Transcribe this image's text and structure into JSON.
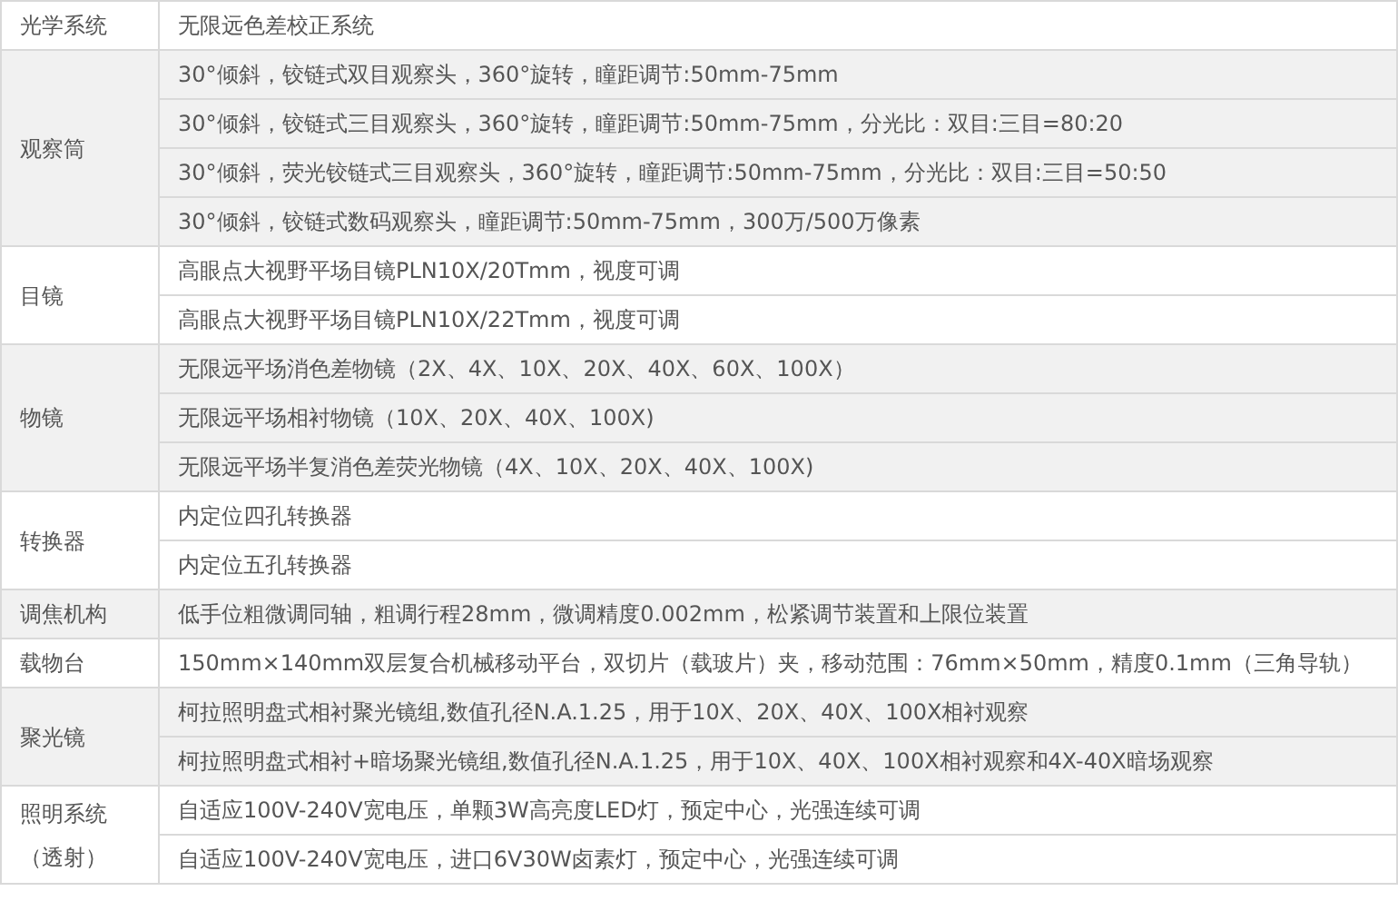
{
  "spec_table": [
    {
      "category": "光学系统",
      "values": [
        "无限远色差校正系统"
      ]
    },
    {
      "category": "观察筒",
      "values": [
        "30°倾斜，铰链式双目观察头，360°旋转，瞳距调节:50mm-75mm",
        "30°倾斜，铰链式三目观察头，360°旋转，瞳距调节:50mm-75mm，分光比：双目:三目=80:20",
        "30°倾斜，荧光铰链式三目观察头，360°旋转，瞳距调节:50mm-75mm，分光比：双目:三目=50:50",
        "30°倾斜，铰链式数码观察头，瞳距调节:50mm-75mm，300万/500万像素"
      ]
    },
    {
      "category": "目镜",
      "values": [
        "高眼点大视野平场目镜PLN10X/20Tmm，视度可调",
        "高眼点大视野平场目镜PLN10X/22Tmm，视度可调"
      ]
    },
    {
      "category": "物镜",
      "values": [
        "无限远平场消色差物镜（2X、4X、10X、20X、40X、60X、100X）",
        "无限远平场相衬物镜（10X、20X、40X、100X)",
        "无限远平场半复消色差荧光物镜（4X、10X、20X、40X、100X)"
      ]
    },
    {
      "category": "转换器",
      "values": [
        "内定位四孔转换器",
        "内定位五孔转换器"
      ]
    },
    {
      "category": "调焦机构",
      "values": [
        "低手位粗微调同轴，粗调行程28mm，微调精度0.002mm，松紧调节装置和上限位装置"
      ]
    },
    {
      "category": "载物台",
      "values": [
        "150mm×140mm双层复合机械移动平台，双切片（载玻片）夹，移动范围：76mm×50mm，精度0.1mm（三角导轨）"
      ]
    },
    {
      "category": "聚光镜",
      "values": [
        "柯拉照明盘式相衬聚光镜组,数值孔径N.A.1.25，用于10X、20X、40X、100X相衬观察",
        "柯拉照明盘式相衬+暗场聚光镜组,数值孔径N.A.1.25，用于10X、40X、100X相衬观察和4X-40X暗场观察"
      ]
    },
    {
      "category": "照明系统（透射）",
      "values": [
        "自适应100V-240V宽电压，单颗3W高亮度LED灯，预定中心，光强连续可调",
        "自适应100V-240V宽电压，进口6V30W卤素灯，预定中心，光强连续可调"
      ]
    }
  ]
}
